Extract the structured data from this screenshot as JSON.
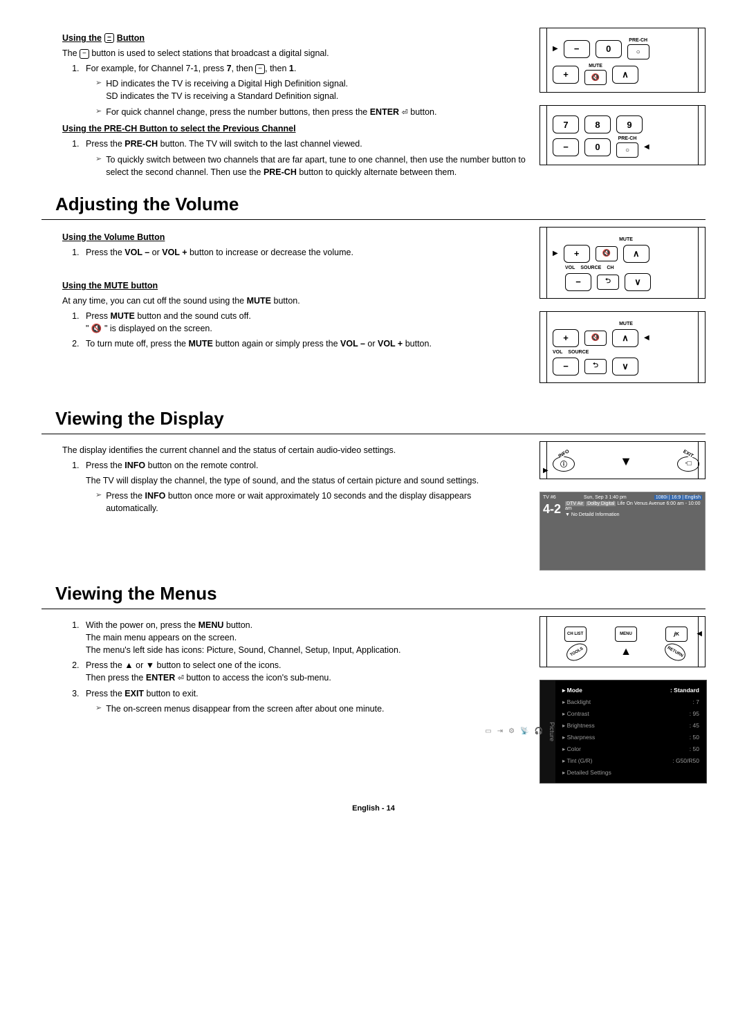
{
  "s0": {
    "sub1": "Using the",
    "sub1_btn": "−",
    "sub1_after": " Button",
    "intro_pre": "The ",
    "intro_btn": "−",
    "intro_post": " button is used to select stations that broadcast a digital signal.",
    "l1_pre": "For example, for Channel 7-1, press ",
    "l1_b1": "7",
    "l1_mid": ", then ",
    "l1_btn": "−",
    "l1_post": ", then ",
    "l1_b2": "1",
    "p1a": "HD indicates the TV is receiving a Digital High Definition signal.",
    "p1b": "SD indicates the TV is receiving a Standard Definition signal.",
    "p2_pre": "For quick channel change, press the number buttons, then press the ",
    "p2_b": "ENTER",
    "p2_post": " button.",
    "sub2": "Using the PRE-CH Button to select the Previous Channel",
    "l2_pre": "Press the ",
    "l2_b": "PRE-CH",
    "l2_post": " button. The TV will switch to the last channel viewed.",
    "p3_a": "To quickly switch between two channels that are far apart, tune to one channel, then use the number button to select the second channel. Then use the ",
    "p3_b": "PRE-CH",
    "p3_c": " button to quickly alternate between them."
  },
  "s1": {
    "title": "Adjusting the Volume",
    "sub1": "Using the Volume Button",
    "l1_pre": "Press the ",
    "l1_b1": "VOL –",
    "l1_mid": " or ",
    "l1_b2": "VOL +",
    "l1_post": " button to increase or decrease the volume.",
    "sub2": "Using the MUTE button",
    "intro2_pre": "At any time, you can cut off the sound using the ",
    "intro2_b": "MUTE",
    "intro2_post": " button.",
    "m1_pre": "Press ",
    "m1_b": "MUTE",
    "m1_post": " button and the sound cuts off.",
    "m1_line2": "\" 🔇 \" is displayed on the screen.",
    "m2_pre": "To turn mute off, press the ",
    "m2_b": "MUTE",
    "m2_mid": " button again or simply press the ",
    "m2_b2": "VOL –",
    "m2_or": " or ",
    "m2_b3": "VOL +",
    "m2_post": " button."
  },
  "s2": {
    "title": "Viewing the Display",
    "intro": "The display identifies the current channel and the status of certain audio-video settings.",
    "l1_pre": "Press the ",
    "l1_b": "INFO",
    "l1_post": " button on the remote control.",
    "l1_p": "The TV will display the channel, the type of sound, and the status of certain picture and sound settings.",
    "p1_pre": "Press the ",
    "p1_b": "INFO",
    "p1_post": " button once more or wait approximately 10 seconds and the display disappears automatically."
  },
  "s3": {
    "title": "Viewing the Menus",
    "l1_pre": "With the power on, press the ",
    "l1_b": "MENU",
    "l1_post": " button.",
    "l1_p1": "The main menu appears on the screen.",
    "l1_p2": "The menu's left side has icons: Picture, Sound, Channel, Setup, Input, Application.",
    "l2_pre": "Press the ▲ or ▼ button to select one of the icons.",
    "l2_p_pre": "Then press the ",
    "l2_p_b": "ENTER",
    "l2_p_post": " button to access the icon's sub-menu.",
    "l3_pre": "Press the ",
    "l3_b": "EXIT",
    "l3_post": " button to exit.",
    "p1": "The on-screen menus disappear from the screen after about one minute."
  },
  "fig1": {
    "dash": "−",
    "zero": "0",
    "prech": "PRE-CH",
    "plus": "+",
    "mute": "MUTE",
    "muteicon": "🔇",
    "up": "∧"
  },
  "fig2": {
    "n7": "7",
    "n8": "8",
    "n9": "9",
    "dash": "−",
    "zero": "0",
    "prech": "PRE-CH"
  },
  "fig3": {
    "plus": "+",
    "minus": "−",
    "mute": "MUTE",
    "muteicon": "🔇",
    "up": "∧",
    "dn": "∨",
    "vol": "VOL",
    "src": "SOURCE",
    "ch": "CH",
    "srcicon": "⮌"
  },
  "fig5": {
    "info": "INFO",
    "exit": "EXIT",
    "i": "ⓘ",
    "e": "⋅□"
  },
  "fig6": {
    "chlist": "CH LIST",
    "menu": "MENU",
    "tools": "TOOLS",
    "return": "RETURN"
  },
  "info_shot": {
    "tv": "TV #6",
    "date": "Sun, Sep 3 1:40 pm",
    "res": "1080i | 16:9 | English",
    "dtv": "DTV Air",
    "dolby": "Dolby Digital",
    "ch": "4-2",
    "prog": "Life On Venus Avenue",
    "time": "6:00 am - 10:00 am",
    "nd": "No Detaild Information"
  },
  "menu_shot": {
    "side": "Picture",
    "rows": [
      {
        "k": "Mode",
        "v": "Standard",
        "hl": true
      },
      {
        "k": "Backlight",
        "v": "7"
      },
      {
        "k": "Contrast",
        "v": "95"
      },
      {
        "k": "Brightness",
        "v": "45"
      },
      {
        "k": "Sharpness",
        "v": "50"
      },
      {
        "k": "Color",
        "v": "50"
      },
      {
        "k": "Tint (G/R)",
        "v": "G50/R50"
      },
      {
        "k": "Detailed Settings",
        "v": ""
      }
    ]
  },
  "footer": "English - 14"
}
